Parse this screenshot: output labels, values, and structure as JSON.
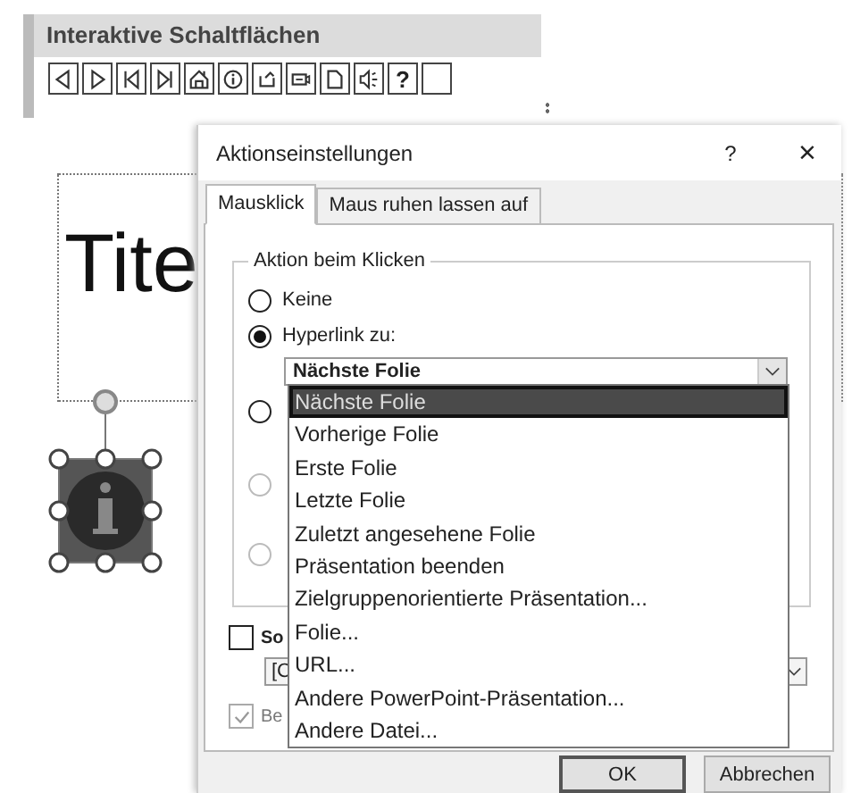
{
  "toolbar": {
    "title": "Interaktive Schaltflächen",
    "buttons": [
      {
        "kind": "back"
      },
      {
        "kind": "forward"
      },
      {
        "kind": "start"
      },
      {
        "kind": "end"
      },
      {
        "kind": "home"
      },
      {
        "kind": "info"
      },
      {
        "kind": "return"
      },
      {
        "kind": "movie"
      },
      {
        "kind": "document"
      },
      {
        "kind": "sound"
      },
      {
        "kind": "text",
        "label": "?"
      },
      {
        "kind": "blank"
      }
    ]
  },
  "slide": {
    "title": "Tite"
  },
  "dialog": {
    "title": "Aktionseinstellungen",
    "help": "?",
    "close": "×",
    "tabs": [
      {
        "label": "Mausklick",
        "selected": true
      },
      {
        "label": "Maus ruhen lassen auf",
        "selected": false
      }
    ],
    "group": {
      "legend": "Aktion beim Klicken",
      "options": [
        {
          "label": "Keine",
          "selected": false,
          "disabled": false
        },
        {
          "label": "Hyperlink zu:",
          "selected": true,
          "disabled": false
        },
        {
          "selected": false,
          "disabled": false
        },
        {
          "selected": false,
          "disabled": true
        },
        {
          "selected": false,
          "disabled": true
        }
      ],
      "hyperlink_value": "Nächste Folie"
    },
    "sound": {
      "label": "So",
      "checked": false,
      "disabled": false,
      "value": "[C"
    },
    "highlight": {
      "label": "Be",
      "checked": true,
      "disabled": true
    },
    "dropdown": [
      {
        "label": "Nächste Folie",
        "selected": true
      },
      {
        "label": "Vorherige Folie",
        "selected": false
      },
      {
        "label": "Erste Folie",
        "selected": false
      },
      {
        "label": "Letzte Folie",
        "selected": false
      },
      {
        "label": "Zuletzt angesehene Folie",
        "selected": false
      },
      {
        "label": "Präsentation beenden",
        "selected": false
      },
      {
        "label": "Zielgruppenorientierte Präsentation...",
        "selected": false
      },
      {
        "label": "Folie...",
        "selected": false
      },
      {
        "label": "URL...",
        "selected": false
      },
      {
        "label": "Andere PowerPoint-Präsentation...",
        "selected": false
      },
      {
        "label": "Andere Datei...",
        "selected": false
      }
    ],
    "buttons": [
      {
        "label": "OK",
        "default": true
      },
      {
        "label": "Abbrechen",
        "default": false
      }
    ]
  }
}
